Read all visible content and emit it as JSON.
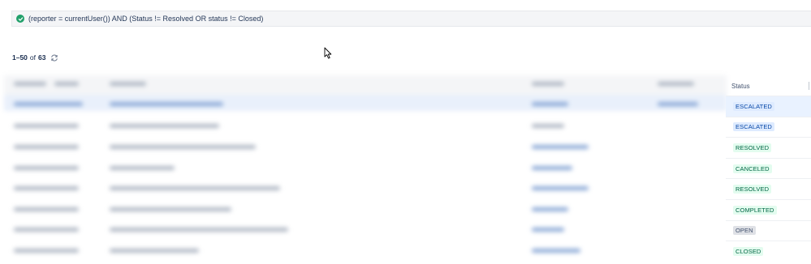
{
  "jql": {
    "query": "(reporter = currentUser()) AND (Status != Resolved OR status != Closed)"
  },
  "pagination": {
    "range": "1–50",
    "of_label": "of",
    "total": "63"
  },
  "table": {
    "status_header": "Status",
    "rows": [
      {
        "status": "ESCALATED",
        "color": "blue",
        "selected": true
      },
      {
        "status": "ESCALATED",
        "color": "blue"
      },
      {
        "status": "RESOLVED",
        "color": "green"
      },
      {
        "status": "CANCELED",
        "color": "green"
      },
      {
        "status": "RESOLVED",
        "color": "green"
      },
      {
        "status": "COMPLETED",
        "color": "green"
      },
      {
        "status": "OPEN",
        "color": "grey"
      },
      {
        "status": "CLOSED",
        "color": "green"
      }
    ]
  },
  "colors": {
    "blue_lozenge": "#deebff",
    "green_lozenge": "#e3fcef",
    "grey_lozenge": "#dfe1e6",
    "valid_check": "#22a06b"
  },
  "icons": [
    "check-circle-icon",
    "refresh-icon",
    "mouse-cursor-icon"
  ]
}
